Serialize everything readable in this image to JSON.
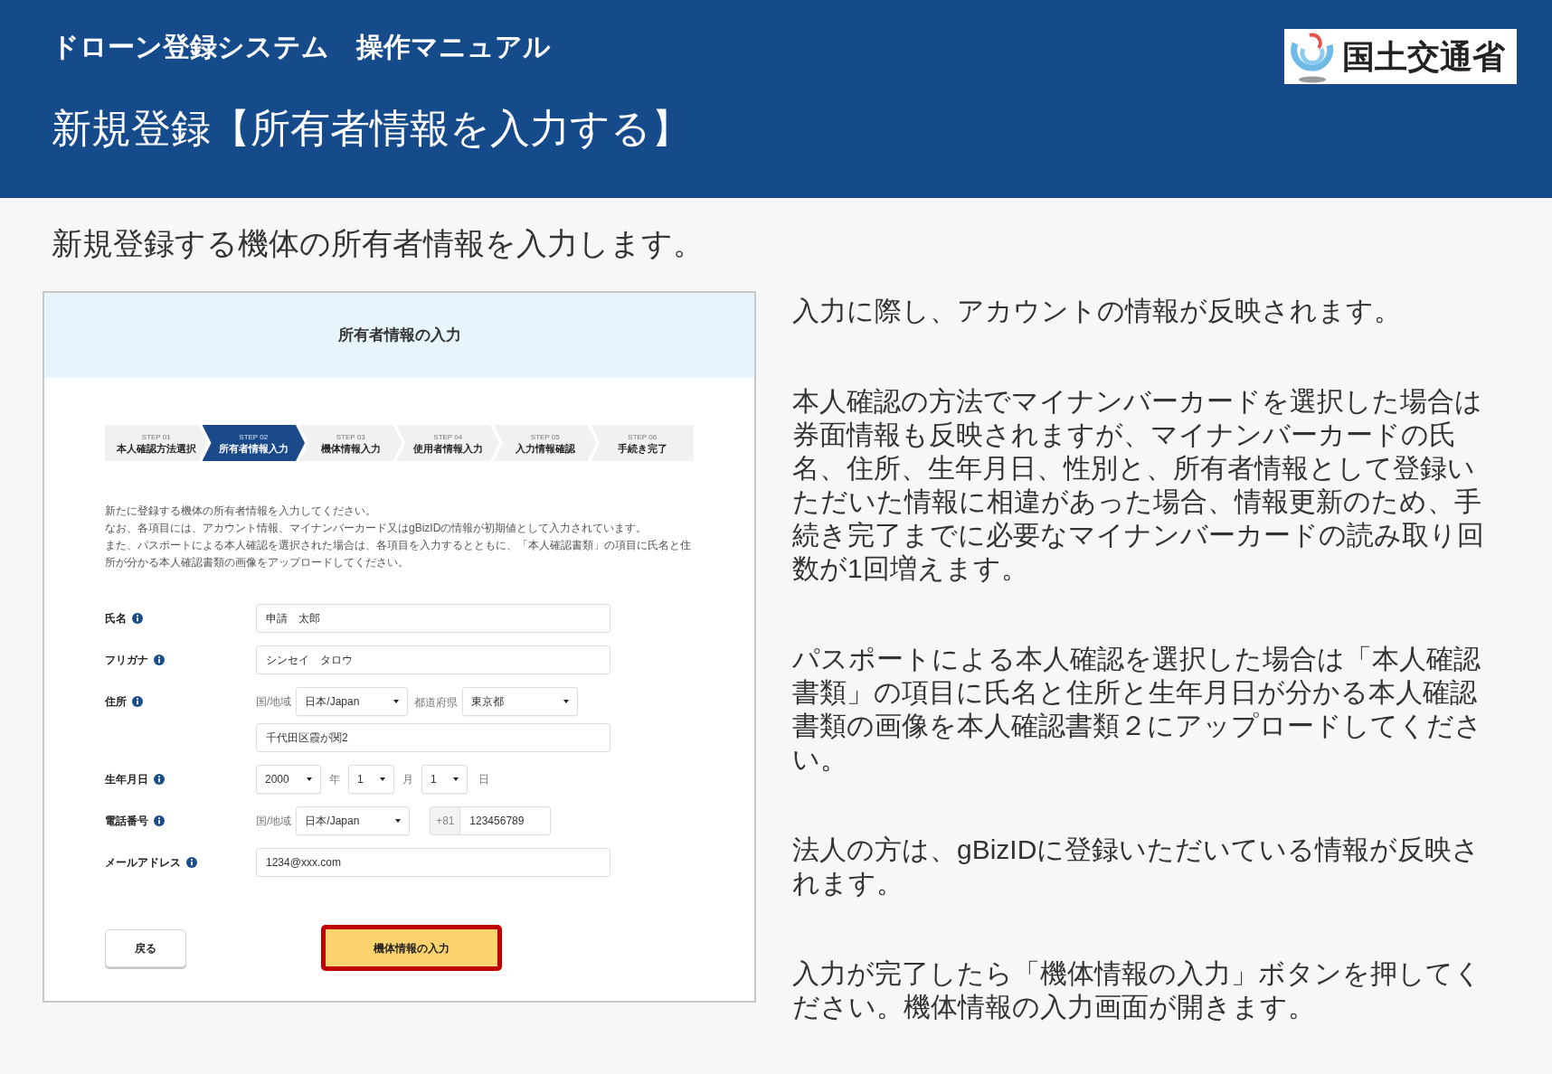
{
  "header": {
    "system_title": "ドローン登録システム　操作マニュアル",
    "page_title": "新規登録【所有者情報を入力する】",
    "logo_text": "国土交通省"
  },
  "intro": "新規登録する機体の所有者情報を入力します。",
  "screenshot": {
    "title": "所有者情報の入力",
    "steps": [
      {
        "number": "STEP 01",
        "label": "本人確認方法選択",
        "selected": false
      },
      {
        "number": "STEP 02",
        "label": "所有者情報入力",
        "selected": true
      },
      {
        "number": "STEP 03",
        "label": "機体情報入力",
        "selected": false
      },
      {
        "number": "STEP 04",
        "label": "使用者情報入力",
        "selected": false
      },
      {
        "number": "STEP 05",
        "label": "入力情報確認",
        "selected": false
      },
      {
        "number": "STEP 06",
        "label": "手続き完了",
        "selected": false
      }
    ],
    "notes": [
      "新たに登録する機体の所有者情報を入力してください。",
      "なお、各項目には、アカウント情報、マイナンバーカード又はgBizIDの情報が初期値として入力されています。",
      "また、パスポートによる本人確認を選択された場合は、各項目を入力するとともに、「本人確認書類」の項目に氏名と住所が分かる本人確認書類の画像をアップロードしてください。"
    ],
    "fields": [
      {
        "kind": "text",
        "label": "氏名",
        "value": "申請　太郎"
      },
      {
        "kind": "text",
        "label": "フリガナ",
        "value": "シンセイ　タロウ"
      },
      {
        "kind": "address",
        "label": "住所",
        "country_label": "国/地域",
        "country": "日本/Japan",
        "prefecture_label": "都道府県",
        "prefecture": "東京都",
        "street": "千代田区霞が関2"
      },
      {
        "kind": "date",
        "label": "生年月日",
        "year": "2000",
        "year_unit": "年",
        "month": "1",
        "month_unit": "月",
        "day": "1",
        "day_unit": "日"
      },
      {
        "kind": "phone",
        "label": "電話番号",
        "country_label": "国/地域",
        "country": "日本/Japan",
        "prefix": "+81",
        "number": "123456789"
      },
      {
        "kind": "text",
        "label": "メールアドレス",
        "value": "1234@xxx.com"
      }
    ],
    "buttons": [
      {
        "kind": "back",
        "label": "戻る",
        "highlighted": false
      },
      {
        "kind": "primary",
        "label": "機体情報の入力",
        "highlighted": true
      }
    ]
  },
  "explanations": [
    "入力に際し、アカウントの情報が反映されます。",
    "本人確認の方法でマイナンバーカードを選択した場合は券面情報も反映されますが、マイナンバーカードの氏名、住所、生年月日、性別と、所有者情報として登録いただいた情報に相違があった場合、情報更新のため、手続き完了までに必要なマイナンバーカードの読み取り回数が1回増えます。",
    "パスポートによる本人確認を選択した場合は「本人確認書類」の項目に氏名と住所と生年月日が分かる本人確認書類の画像を本人確認書類２にアップロードしてください。",
    "法人の方は、gBizIDに登録いただいている情報が反映されます。",
    "入力が完了したら「機体情報の入力」ボタンを押してください。機体情報の入力画面が開きます。"
  ]
}
